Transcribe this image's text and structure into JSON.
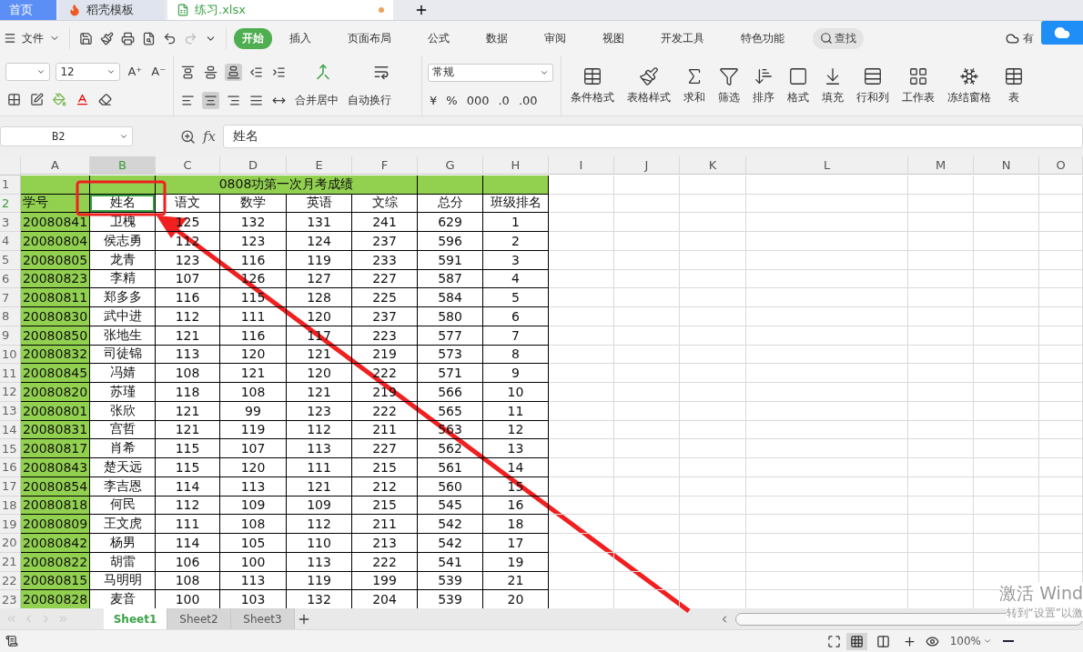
{
  "tabs": [
    {
      "label": "首页",
      "kind": "home",
      "selected": false
    },
    {
      "label": "稻壳模板",
      "kind": "template",
      "selected": false
    },
    {
      "label": "练习.xlsx",
      "kind": "file",
      "selected": true,
      "unsaved": true
    }
  ],
  "menu": {
    "file": "文件",
    "items": [
      {
        "label": "开始",
        "selected": true
      },
      {
        "label": "插入",
        "selected": false
      },
      {
        "label": "页面布局",
        "selected": false
      },
      {
        "label": "公式",
        "selected": false
      },
      {
        "label": "数据",
        "selected": false
      },
      {
        "label": "审阅",
        "selected": false
      },
      {
        "label": "视图",
        "selected": false
      },
      {
        "label": "开发工具",
        "selected": false
      },
      {
        "label": "特色功能",
        "selected": false
      }
    ],
    "search": "查找",
    "cloud": "有"
  },
  "ribbon": {
    "font_size": "12",
    "font_grow": "A⁺",
    "font_shrink": "A⁻",
    "number_format": "常规",
    "merge": "合并居中",
    "wrap": "自动换行",
    "number_buttons": [
      "¥",
      "%",
      "000",
      ".0",
      ".00"
    ],
    "buttons": [
      {
        "label": "条件格式",
        "kind": "conditional"
      },
      {
        "label": "表格样式",
        "kind": "tablestyle"
      },
      {
        "label": "求和",
        "kind": "sum"
      },
      {
        "label": "筛选",
        "kind": "filter"
      },
      {
        "label": "排序",
        "kind": "sort"
      },
      {
        "label": "格式",
        "kind": "format"
      },
      {
        "label": "填充",
        "kind": "fill"
      },
      {
        "label": "行和列",
        "kind": "rowcol"
      },
      {
        "label": "工作表",
        "kind": "sheet"
      },
      {
        "label": "冻结窗格",
        "kind": "freeze"
      },
      {
        "label": "表",
        "kind": "more"
      }
    ]
  },
  "formula_bar": {
    "cell_ref": "B2",
    "fx": "fx",
    "value": "姓名"
  },
  "sheet": {
    "columns": [
      {
        "label": "A",
        "selected": false
      },
      {
        "label": "B",
        "selected": true
      },
      {
        "label": "C",
        "selected": false
      },
      {
        "label": "D",
        "selected": false
      },
      {
        "label": "E",
        "selected": false
      },
      {
        "label": "F",
        "selected": false
      },
      {
        "label": "G",
        "selected": false
      },
      {
        "label": "H",
        "selected": false
      },
      {
        "label": "I",
        "selected": false
      },
      {
        "label": "J",
        "selected": false
      },
      {
        "label": "K",
        "selected": false
      },
      {
        "label": "L",
        "selected": false
      },
      {
        "label": "M",
        "selected": false
      },
      {
        "label": "N",
        "selected": false
      },
      {
        "label": "O",
        "selected": false
      }
    ],
    "row_numbers": [
      {
        "label": "1",
        "selected": false
      },
      {
        "label": "2",
        "selected": true
      },
      {
        "label": "3",
        "selected": false
      },
      {
        "label": "4",
        "selected": false
      },
      {
        "label": "5",
        "selected": false
      },
      {
        "label": "6",
        "selected": false
      },
      {
        "label": "7",
        "selected": false
      },
      {
        "label": "8",
        "selected": false
      },
      {
        "label": "9",
        "selected": false
      },
      {
        "label": "10",
        "selected": false
      },
      {
        "label": "11",
        "selected": false
      },
      {
        "label": "12",
        "selected": false
      },
      {
        "label": "13",
        "selected": false
      },
      {
        "label": "14",
        "selected": false
      },
      {
        "label": "15",
        "selected": false
      },
      {
        "label": "16",
        "selected": false
      },
      {
        "label": "17",
        "selected": false
      },
      {
        "label": "18",
        "selected": false
      },
      {
        "label": "19",
        "selected": false
      },
      {
        "label": "20",
        "selected": false
      },
      {
        "label": "21",
        "selected": false
      },
      {
        "label": "22",
        "selected": false
      },
      {
        "label": "23",
        "selected": false
      }
    ],
    "title": "0808功第一次月考成绩",
    "headers": [
      "学号",
      "姓名",
      "语文",
      "数学",
      "英语",
      "文综",
      "总分",
      "班级排名"
    ],
    "rows": [
      [
        "20080841",
        "卫槐",
        "125",
        "132",
        "131",
        "241",
        "629",
        "1"
      ],
      [
        "20080804",
        "侯志勇",
        "112",
        "123",
        "124",
        "237",
        "596",
        "2"
      ],
      [
        "20080805",
        "龙青",
        "123",
        "116",
        "119",
        "233",
        "591",
        "3"
      ],
      [
        "20080823",
        "李精",
        "107",
        "126",
        "127",
        "227",
        "587",
        "4"
      ],
      [
        "20080811",
        "郑多多",
        "116",
        "115",
        "128",
        "225",
        "584",
        "5"
      ],
      [
        "20080830",
        "武中进",
        "112",
        "111",
        "120",
        "237",
        "580",
        "6"
      ],
      [
        "20080850",
        "张地生",
        "121",
        "116",
        "117",
        "223",
        "577",
        "7"
      ],
      [
        "20080832",
        "司徒锦",
        "113",
        "120",
        "121",
        "219",
        "573",
        "8"
      ],
      [
        "20080845",
        "冯婧",
        "108",
        "121",
        "120",
        "222",
        "571",
        "9"
      ],
      [
        "20080820",
        "苏瑾",
        "118",
        "108",
        "121",
        "219",
        "566",
        "10"
      ],
      [
        "20080801",
        "张欣",
        "121",
        "99",
        "123",
        "222",
        "565",
        "11"
      ],
      [
        "20080831",
        "宫哲",
        "121",
        "119",
        "112",
        "211",
        "563",
        "12"
      ],
      [
        "20080817",
        "肖希",
        "115",
        "107",
        "113",
        "227",
        "562",
        "13"
      ],
      [
        "20080843",
        "楚天远",
        "115",
        "120",
        "111",
        "215",
        "561",
        "14"
      ],
      [
        "20080854",
        "李吉恩",
        "114",
        "113",
        "121",
        "212",
        "560",
        "15"
      ],
      [
        "20080818",
        "何民",
        "112",
        "109",
        "109",
        "215",
        "545",
        "16"
      ],
      [
        "20080809",
        "王文虎",
        "111",
        "108",
        "112",
        "211",
        "542",
        "18"
      ],
      [
        "20080842",
        "杨男",
        "114",
        "105",
        "110",
        "213",
        "542",
        "17"
      ],
      [
        "20080822",
        "胡雷",
        "106",
        "100",
        "113",
        "222",
        "541",
        "19"
      ],
      [
        "20080815",
        "马明明",
        "108",
        "113",
        "119",
        "199",
        "539",
        "21"
      ],
      [
        "20080828",
        "麦音",
        "100",
        "103",
        "132",
        "204",
        "539",
        "20"
      ]
    ]
  },
  "sheet_tabs": [
    {
      "label": "Sheet1",
      "selected": true
    },
    {
      "label": "Sheet2",
      "selected": false
    },
    {
      "label": "Sheet3",
      "selected": false
    }
  ],
  "status": {
    "zoom": "100%",
    "views": [
      {
        "kind": "normal",
        "selected": true
      },
      {
        "kind": "page",
        "selected": false
      },
      {
        "kind": "break",
        "selected": false
      }
    ]
  },
  "activation": [
    "激活 Wind",
    "转到“设置”以激"
  ]
}
